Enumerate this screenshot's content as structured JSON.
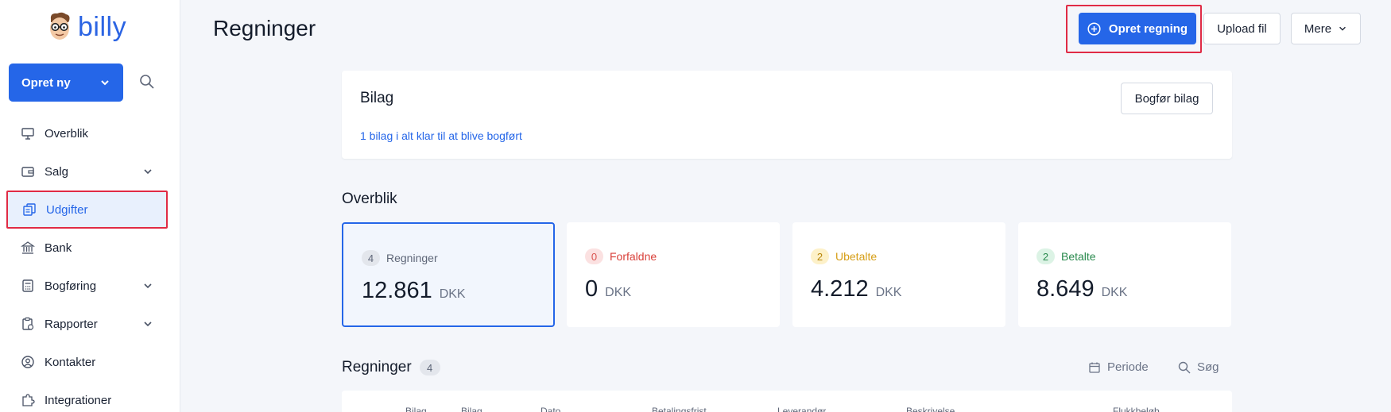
{
  "app": {
    "logo_text": "billy"
  },
  "sidebar": {
    "create_label": "Opret ny",
    "items": [
      {
        "label": "Overblik",
        "icon": "dashboard-icon",
        "has_chevron": false
      },
      {
        "label": "Salg",
        "icon": "wallet-icon",
        "has_chevron": true
      },
      {
        "label": "Udgifter",
        "icon": "documents-icon",
        "has_chevron": false,
        "active": true
      },
      {
        "label": "Bank",
        "icon": "bank-icon",
        "has_chevron": false
      },
      {
        "label": "Bogføring",
        "icon": "calculator-icon",
        "has_chevron": true
      },
      {
        "label": "Rapporter",
        "icon": "report-icon",
        "has_chevron": true
      },
      {
        "label": "Kontakter",
        "icon": "user-circle-icon",
        "has_chevron": false
      },
      {
        "label": "Integrationer",
        "icon": "puzzle-icon",
        "has_chevron": false
      }
    ]
  },
  "header": {
    "title": "Regninger",
    "create_bill_label": "Opret regning",
    "upload_label": "Upload fil",
    "more_label": "Mere"
  },
  "bilag": {
    "title": "Bilag",
    "link_text": "1 bilag i alt klar til at blive bogført",
    "post_button": "Bogfør bilag"
  },
  "overview": {
    "title": "Overblik",
    "cards": [
      {
        "count": "4",
        "label": "Regninger",
        "amount": "12.861",
        "currency": "DKK",
        "badge_bg": "#e3e6ec",
        "badge_fg": "#5e6678",
        "label_color": "#5e6678"
      },
      {
        "count": "0",
        "label": "Forfaldne",
        "amount": "0",
        "currency": "DKK",
        "badge_bg": "#fbe1e1",
        "badge_fg": "#d9534f",
        "label_color": "#d9403a"
      },
      {
        "count": "2",
        "label": "Ubetalte",
        "amount": "4.212",
        "currency": "DKK",
        "badge_bg": "#fdf1c9",
        "badge_fg": "#b8860b",
        "label_color": "#d69e16"
      },
      {
        "count": "2",
        "label": "Betalte",
        "amount": "8.649",
        "currency": "DKK",
        "badge_bg": "#dcf3e5",
        "badge_fg": "#2a8a4e",
        "label_color": "#2a8a4e"
      }
    ]
  },
  "bills": {
    "title": "Regninger",
    "count": "4",
    "period_label": "Periode",
    "search_label": "Søg",
    "columns": [
      "Bilag",
      "Bilag",
      "Dato",
      "Betalingsfrist",
      "Leverandør",
      "Beskrivelse",
      "Flukkbeløb"
    ]
  },
  "colors": {
    "primary": "#2566e8",
    "highlight": "#e02b45"
  }
}
